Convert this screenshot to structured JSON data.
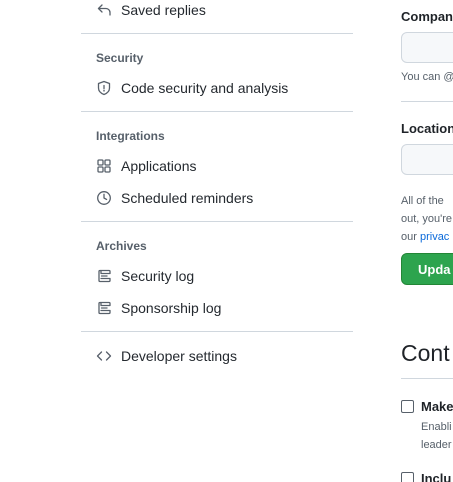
{
  "sidebar": {
    "saved_replies": {
      "label": "Saved replies",
      "icon": "reply-icon"
    },
    "security": {
      "heading": "Security",
      "items": [
        {
          "label": "Code security and analysis",
          "icon": "shield-icon"
        }
      ]
    },
    "integrations": {
      "heading": "Integrations",
      "items": [
        {
          "label": "Applications",
          "icon": "apps-grid-icon"
        },
        {
          "label": "Scheduled reminders",
          "icon": "clock-icon"
        }
      ]
    },
    "archives": {
      "heading": "Archives",
      "items": [
        {
          "label": "Security log",
          "icon": "log-icon"
        },
        {
          "label": "Sponsorship log",
          "icon": "log-icon"
        }
      ]
    },
    "developer_settings": {
      "label": "Developer settings",
      "icon": "code-icon"
    }
  },
  "main": {
    "company": {
      "label": "Compan",
      "value": "",
      "note": "You can @"
    },
    "location": {
      "label": "Location",
      "value": ""
    },
    "privacy_note": {
      "line1": "All of the",
      "line2": "out, you're",
      "line3_prefix": "our ",
      "line3_link": "privac"
    },
    "update_button": "Upda",
    "contributions_title": "Cont",
    "checkbox_make": {
      "label": "Make",
      "desc_line1": "Enabli",
      "desc_line2": "leader",
      "checked": false
    },
    "checkbox_include": {
      "label": "Inclu",
      "checked": false
    }
  },
  "colors": {
    "accent_green": "#2da44e",
    "link_blue": "#0969da",
    "border": "#d0d7de",
    "muted_text": "#57606a"
  }
}
